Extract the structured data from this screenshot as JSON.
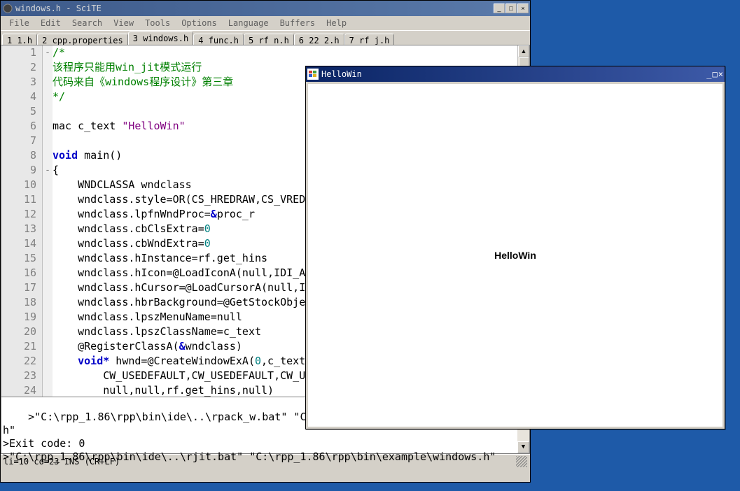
{
  "scite": {
    "title": "windows.h - SciTE",
    "menus": [
      "File",
      "Edit",
      "Search",
      "View",
      "Tools",
      "Options",
      "Language",
      "Buffers",
      "Help"
    ],
    "tabs": [
      {
        "label": "1 1.h"
      },
      {
        "label": "2 cpp.properties"
      },
      {
        "label": "3 windows.h",
        "active": true
      },
      {
        "label": "4 func.h"
      },
      {
        "label": "5 rf_n.h"
      },
      {
        "label": "6 22_2.h"
      },
      {
        "label": "7 rf_j.h"
      }
    ],
    "lines": [
      {
        "n": 1,
        "fold": "-",
        "t": [
          {
            "c": "cm",
            "s": "/*"
          }
        ]
      },
      {
        "n": 2,
        "fold": "",
        "t": [
          {
            "c": "cm",
            "s": "该程序只能用win_jit模式运行"
          }
        ]
      },
      {
        "n": 3,
        "fold": "",
        "t": [
          {
            "c": "cm",
            "s": "代码来自《windows程序设计》第三章"
          }
        ]
      },
      {
        "n": 4,
        "fold": "",
        "t": [
          {
            "c": "cm",
            "s": "*/"
          }
        ]
      },
      {
        "n": 5,
        "fold": "",
        "t": []
      },
      {
        "n": 6,
        "fold": "",
        "t": [
          {
            "c": "",
            "s": "mac c_text "
          },
          {
            "c": "str",
            "s": "\"HelloWin\""
          }
        ]
      },
      {
        "n": 7,
        "fold": "",
        "t": []
      },
      {
        "n": 8,
        "fold": "",
        "t": [
          {
            "c": "kw",
            "s": "void"
          },
          {
            "c": "",
            "s": " main()"
          }
        ]
      },
      {
        "n": 9,
        "fold": "-",
        "t": [
          {
            "c": "",
            "s": "{"
          }
        ]
      },
      {
        "n": 10,
        "fold": "",
        "t": [
          {
            "c": "",
            "s": "    WNDCLASSA wndclass"
          }
        ]
      },
      {
        "n": 11,
        "fold": "",
        "t": [
          {
            "c": "",
            "s": "    wndclass.style=OR(CS_HREDRAW,CS_VRED"
          }
        ]
      },
      {
        "n": 12,
        "fold": "",
        "t": [
          {
            "c": "",
            "s": "    wndclass.lpfnWndProc="
          },
          {
            "c": "kw",
            "s": "&"
          },
          {
            "c": "",
            "s": "proc_r"
          }
        ]
      },
      {
        "n": 13,
        "fold": "",
        "t": [
          {
            "c": "",
            "s": "    wndclass.cbClsExtra="
          },
          {
            "c": "num",
            "s": "0"
          }
        ]
      },
      {
        "n": 14,
        "fold": "",
        "t": [
          {
            "c": "",
            "s": "    wndclass.cbWndExtra="
          },
          {
            "c": "num",
            "s": "0"
          }
        ]
      },
      {
        "n": 15,
        "fold": "",
        "t": [
          {
            "c": "",
            "s": "    wndclass.hInstance=rf.get_hins"
          }
        ]
      },
      {
        "n": 16,
        "fold": "",
        "t": [
          {
            "c": "",
            "s": "    wndclass.hIcon=@LoadIconA(null,IDI_A"
          }
        ]
      },
      {
        "n": 17,
        "fold": "",
        "t": [
          {
            "c": "",
            "s": "    wndclass.hCursor=@LoadCursorA(null,I"
          }
        ]
      },
      {
        "n": 18,
        "fold": "",
        "t": [
          {
            "c": "",
            "s": "    wndclass.hbrBackground=@GetStockObje"
          }
        ]
      },
      {
        "n": 19,
        "fold": "",
        "t": [
          {
            "c": "",
            "s": "    wndclass.lpszMenuName=null"
          }
        ]
      },
      {
        "n": 20,
        "fold": "",
        "t": [
          {
            "c": "",
            "s": "    wndclass.lpszClassName=c_text"
          }
        ]
      },
      {
        "n": 21,
        "fold": "",
        "t": [
          {
            "c": "",
            "s": "    @RegisterClassA("
          },
          {
            "c": "kw",
            "s": "&"
          },
          {
            "c": "",
            "s": "wndclass)"
          }
        ]
      },
      {
        "n": 22,
        "fold": "",
        "t": [
          {
            "c": "",
            "s": "    "
          },
          {
            "c": "kw",
            "s": "void*"
          },
          {
            "c": "",
            "s": " hwnd=@CreateWindowExA("
          },
          {
            "c": "num",
            "s": "0"
          },
          {
            "c": "",
            "s": ",c_text"
          }
        ]
      },
      {
        "n": 23,
        "fold": "",
        "t": [
          {
            "c": "",
            "s": "        CW_USEDEFAULT,CW_USEDEFAULT,CW_U"
          }
        ]
      },
      {
        "n": 24,
        "fold": "",
        "t": [
          {
            "c": "",
            "s": "        null,null,rf.get_hins,null)"
          }
        ]
      }
    ],
    "output": ">\"C:\\rpp_1.86\\rpp\\bin\\ide\\..\\rpack_w.bat\" \"C:\\r\nh\"\n>Exit code: 0\n>\"C:\\rpp_1.86\\rpp\\bin\\ide\\..\\rjit.bat\" \"C:\\rpp_1.86\\rpp\\bin\\example\\windows.h\"",
    "status": "li=10 co=23 INS (CR+LF)"
  },
  "hello": {
    "title": "HelloWin",
    "content": "HelloWin"
  },
  "win_controls": {
    "min": "_",
    "max": "□",
    "close": "×"
  }
}
